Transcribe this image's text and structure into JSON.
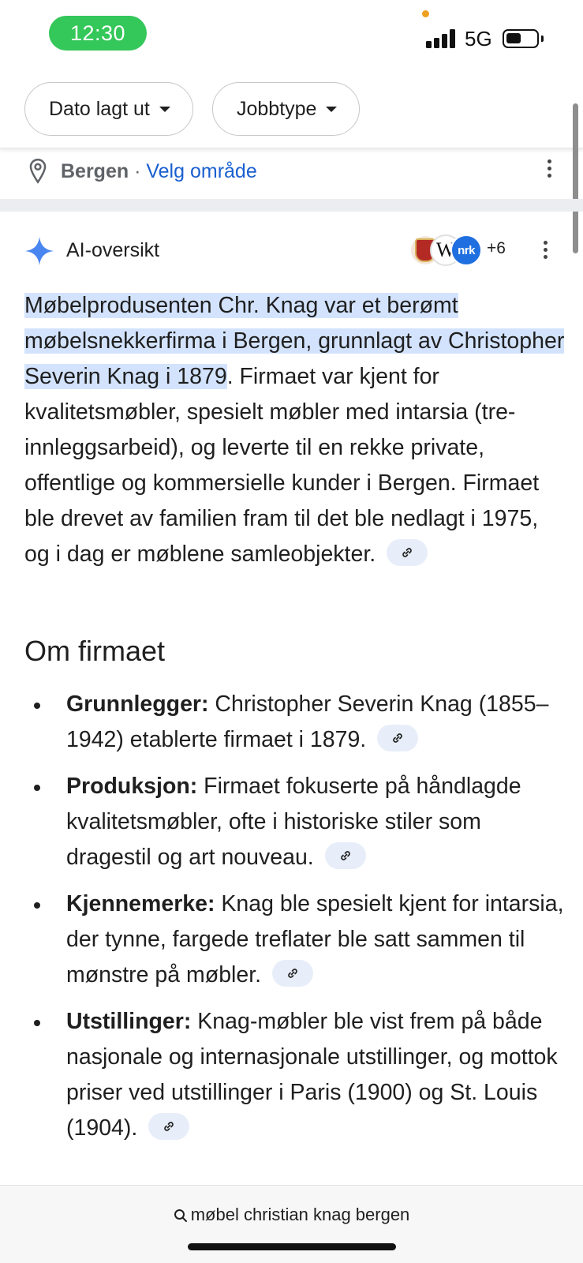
{
  "status_bar": {
    "time": "12:30",
    "network": "5G",
    "battery_level": 0.5,
    "colors": {
      "time_pill": "#34c759",
      "indicator_dot": "#f0a020"
    }
  },
  "filters": {
    "chips": [
      {
        "label": "Dato lagt ut",
        "icon": "caret-down-icon"
      },
      {
        "label": "Jobbtype",
        "icon": "caret-down-icon"
      }
    ]
  },
  "location": {
    "icon": "location-pin-icon",
    "city": "Bergen",
    "separator": " · ",
    "change_link": "Velg område"
  },
  "ai_overview": {
    "icon": "sparkle-icon",
    "title": "AI-oversikt",
    "sources": {
      "icons": [
        "bergen-seal-icon",
        "wikipedia-icon",
        "nrk-icon"
      ],
      "wiki_glyph": "W",
      "nrk_text": "nrk",
      "more_count": "+6"
    },
    "summary": {
      "highlighted": " Møbelprodusenten Chr. Knag var et berømt møbelsnekkerfirma i Bergen, grunnlagt av Christopher Severin Knag i 1879",
      "rest": ". Firmaet var kjent for kvalitetsmøbler, spesielt møbler med intarsia (tre-innleggsarbeid), og leverte til en rekke private, offentlige og kommersielle kunder i Bergen. Firmaet ble drevet av familien fram til det ble nedlagt i 1975, og i dag er møblene samleobjekter."
    },
    "section_title": "Om firmaet",
    "bullets": [
      {
        "term": "Grunnlegger:",
        "text": " Christopher Severin Knag (1855–1942) etablerte firmaet i 1879."
      },
      {
        "term": "Produksjon:",
        "text": " Firmaet fokuserte på håndlagde kvalitetsmøbler, ofte i historiske stiler som dragestil og art nouveau."
      },
      {
        "term": "Kjennemerke:",
        "text": " Knag ble spesielt kjent for intarsia, der tynne, fargede treflater ble satt sammen til mønstre på møbler."
      },
      {
        "term": "Utstillinger:",
        "text": " Knag-møbler ble vist frem på både nasjonale og internasjonale utstillinger, og mottok priser ved utstillinger i Paris (1900) og St. Louis (1904)."
      }
    ],
    "colors": {
      "highlight": "#d3e3fd",
      "link": "#1a5fd0",
      "link_pill": "#e8eef9"
    }
  },
  "search_bar": {
    "icon": "search-icon",
    "query": "møbel christian knag bergen"
  }
}
